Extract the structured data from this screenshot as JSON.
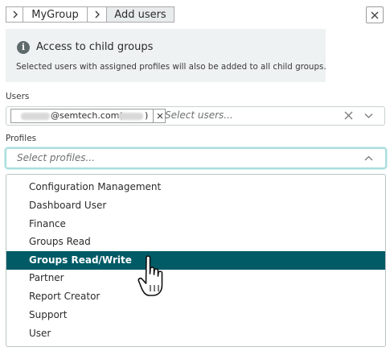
{
  "breadcrumb": {
    "items": [
      "MyGroup",
      "Add users"
    ]
  },
  "info": {
    "title": "Access to child groups",
    "text": "Selected users with assigned profiles will also be added to all child groups.",
    "icon": "info-icon",
    "icon_glyph": "i"
  },
  "users": {
    "label": "Users",
    "chip_text": "@semtech.com(",
    "chip_text_end": ")",
    "placeholder": "Select users..."
  },
  "profiles": {
    "label": "Profiles",
    "placeholder": "Select profiles...",
    "options": [
      "Configuration Management",
      "Dashboard User",
      "Finance",
      "Groups Read",
      "Groups Read/Write",
      "Partner",
      "Report Creator",
      "Support",
      "User"
    ],
    "highlighted": "Groups Read/Write"
  },
  "colors": {
    "accent": "#005b66",
    "focus_border": "#a9dede",
    "panel_bg": "#eef2f2"
  }
}
